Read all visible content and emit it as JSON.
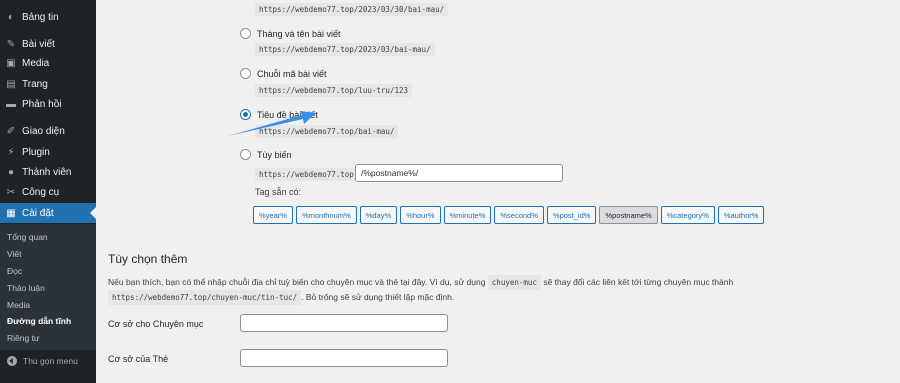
{
  "sidebar": {
    "items": [
      {
        "label": "Bảng tin",
        "icon": "dashboard-icon"
      },
      {
        "label": "Bài viết",
        "icon": "pin-icon"
      },
      {
        "label": "Media",
        "icon": "media-icon"
      },
      {
        "label": "Trang",
        "icon": "page-icon"
      },
      {
        "label": "Phản hồi",
        "icon": "comment-icon"
      },
      {
        "label": "Giao diện",
        "icon": "brush-icon"
      },
      {
        "label": "Plugin",
        "icon": "plugin-icon"
      },
      {
        "label": "Thành viên",
        "icon": "user-icon"
      },
      {
        "label": "Công cụ",
        "icon": "wrench-icon"
      },
      {
        "label": "Cài đặt",
        "icon": "settings-icon"
      }
    ],
    "submenu": [
      "Tổng quan",
      "Viết",
      "Đọc",
      "Thảo luận",
      "Media",
      "Đường dẫn tĩnh",
      "Riêng tư"
    ],
    "collapse_label": "Thu gọn menu"
  },
  "permalinks": {
    "top_url": "https://webdemo77.top/2023/03/30/bai-mau/",
    "options": [
      {
        "label": "Tháng và tên bài viết",
        "url": "https://webdemo77.top/2023/03/bai-mau/",
        "checked": false
      },
      {
        "label": "Chuỗi mã bài viết",
        "url": "https://webdemo77.top/luu-tru/123",
        "checked": false
      },
      {
        "label": "Tiêu đề bài viết",
        "url": "https://webdemo77.top/bai-mau/",
        "checked": true
      }
    ],
    "custom": {
      "label": "Tùy biến",
      "base_url": "https://webdemo77.top",
      "value": "/%postname%/"
    },
    "tags_label": "Tag sẵn có:",
    "tags": [
      "%year%",
      "%monthnum%",
      "%day%",
      "%hour%",
      "%minute%",
      "%second%",
      "%post_id%",
      "%postname%",
      "%category%",
      "%author%"
    ],
    "pressed_tag": "%postname%"
  },
  "optional": {
    "title": "Tùy chọn thêm",
    "desc_part1": "Nếu bạn thích, bạn có thể nhập chuỗi địa chỉ tuỳ biến cho chuyên mục và thẻ tại đây. Ví dụ, sử dụng",
    "desc_code1": "chuyen-muc",
    "desc_part2": "sẽ thay đổi các liên kết tới từng chuyên mục thành",
    "desc_code2": "https://webdemo77.top/chuyen-muc/tin-tuc/",
    "desc_part3": ". Bỏ trống sẽ sử dụng thiết lập mặc định.",
    "category_base_label": "Cơ sở cho Chuyên mục",
    "tag_base_label": "Cơ sở của Thẻ"
  },
  "colors": {
    "sidebar_bg": "#1d2327",
    "accent": "#2271b1",
    "arrow": "#3b8ee8"
  }
}
